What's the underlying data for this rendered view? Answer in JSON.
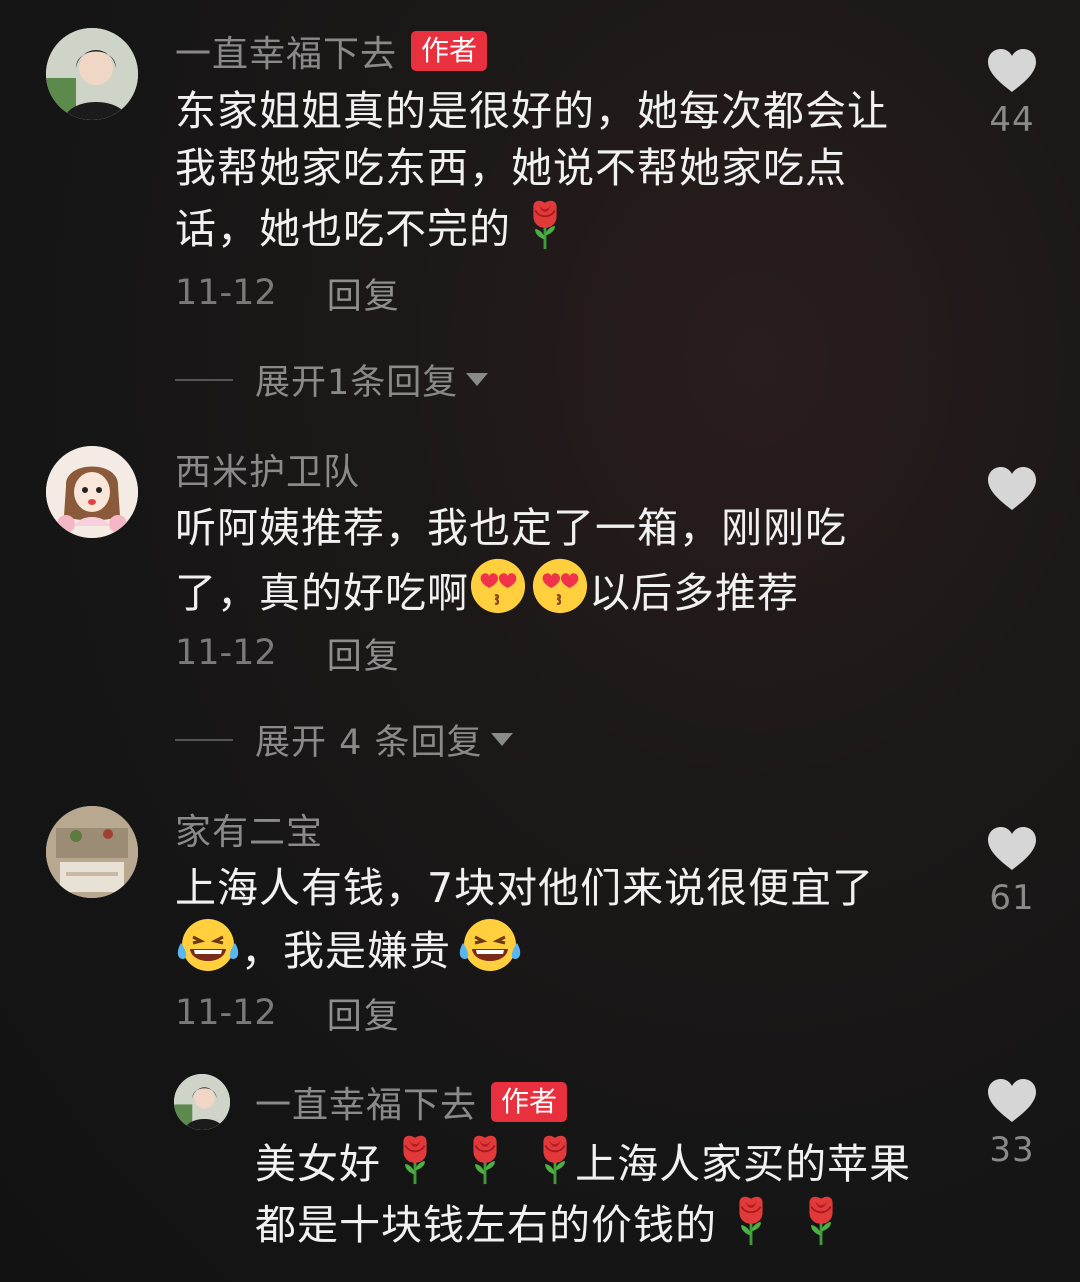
{
  "comments": [
    {
      "username": "一直幸福下去",
      "author_tag": "作者",
      "text_1": "东家姐姐真的是很好的，她每次都会让",
      "text_2": "我帮她家吃东西，她说不帮她家吃点",
      "text_3": "话，她也吃不完的",
      "date": "11-12",
      "reply": "回复",
      "expand": "展开1条回复",
      "likes": "44"
    },
    {
      "username": "西米护卫队",
      "text_1": "听阿姨推荐，我也定了一箱，刚刚吃",
      "text_2a": "了，真的好吃啊",
      "text_2b": "以后多推荐",
      "date": "11-12",
      "reply": "回复",
      "expand": "展开 4 条回复",
      "likes": ""
    },
    {
      "username": "家有二宝",
      "text_1": "上海人有钱，7块对他们来说很便宜了",
      "text_2a": "，我是嫌贵",
      "date": "11-12",
      "reply": "回复",
      "likes": "61"
    },
    {
      "username": "一直幸福下去",
      "author_tag": "作者",
      "text_1a": "美女好",
      "text_1b": "上海人家买的苹果",
      "text_2": "都是十块钱左右的价钱的",
      "likes": "33"
    }
  ],
  "icons": {
    "like": "heart-icon",
    "rose": "rose-emoji",
    "heart_eyes": "heart-eyes-emoji",
    "laugh": "tears-of-joy-emoji",
    "expand": "caret-down-icon"
  },
  "colors": {
    "author_tag": "#e8303e",
    "text": "#f1f1f1",
    "muted": "#8a8a8a"
  }
}
